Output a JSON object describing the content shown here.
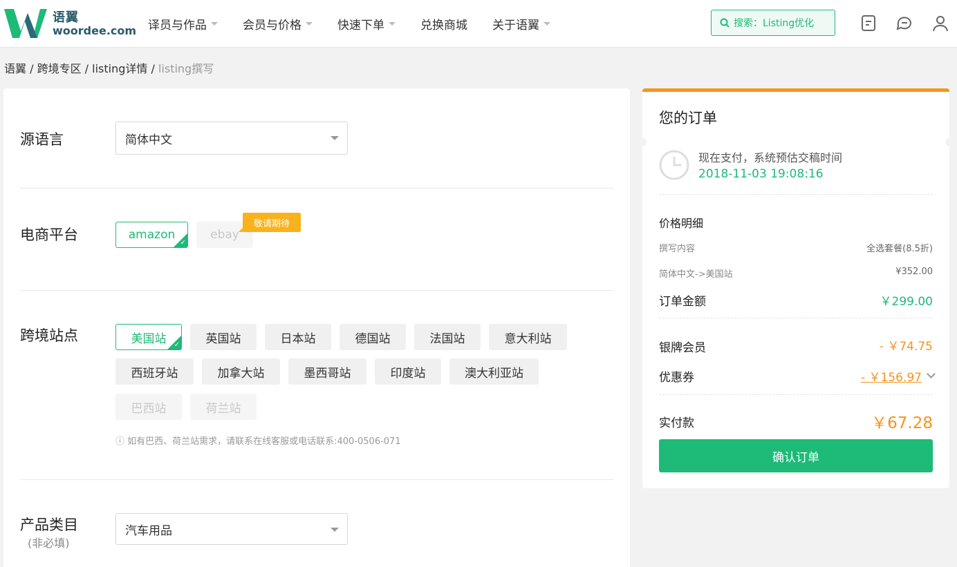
{
  "header": {
    "logo_cn": "语翼",
    "logo_en": "woordee.com",
    "nav": [
      "译员与作品",
      "会员与价格",
      "快速下单",
      "兑换商城",
      "关于语翼"
    ],
    "search_label": "搜索：Listing优化",
    "accent_color": "#1dba78",
    "icons": [
      "document-icon",
      "message-icon",
      "user-icon"
    ]
  },
  "breadcrumb": {
    "items": [
      "语翼",
      "跨境专区",
      "listing详情"
    ],
    "current": "listing撰写",
    "separator": " / "
  },
  "form": {
    "source_lang": {
      "label": "源语言",
      "value": "简体中文"
    },
    "platform": {
      "label": "电商平台",
      "options": [
        "amazon",
        "ebay"
      ],
      "selected": "amazon",
      "coming_soon": "敬请期待"
    },
    "sites": {
      "label": "跨境站点",
      "row1": [
        "美国站",
        "英国站",
        "日本站",
        "德国站",
        "法国站",
        "意大利站"
      ],
      "row2": [
        "西班牙站",
        "加拿大站",
        "墨西哥站",
        "印度站",
        "澳大利亚站"
      ],
      "row3_disabled": [
        "巴西站",
        "荷兰站"
      ],
      "selected": "美国站",
      "note": "ⓘ 如有巴西、荷兰站需求，请联系在线客服或电话联系:400-0506-071"
    },
    "category": {
      "label": "产品类目",
      "sub": "(非必填)",
      "value": "汽车用品"
    }
  },
  "order": {
    "title": "您的订单",
    "time_label": "现在支付，系统预估交稿时间",
    "time_value": "2018-11-03 19:08:16",
    "price_detail": "价格明细",
    "content_label": "撰写内容",
    "content_value": "全选套餐(8.5折)",
    "lang_pair": "简体中文->美国站",
    "lang_price": "¥352.00",
    "amount_label": "订单金额",
    "amount_value": "￥299.00",
    "member_label": "银牌会员",
    "member_value": "- ￥74.75",
    "coupon_label": "优惠券",
    "coupon_value": "- ￥156.97",
    "total_label": "实付款",
    "total_value": "￥67.28",
    "confirm": "确认订单",
    "accent_orange": "#f7941d"
  }
}
